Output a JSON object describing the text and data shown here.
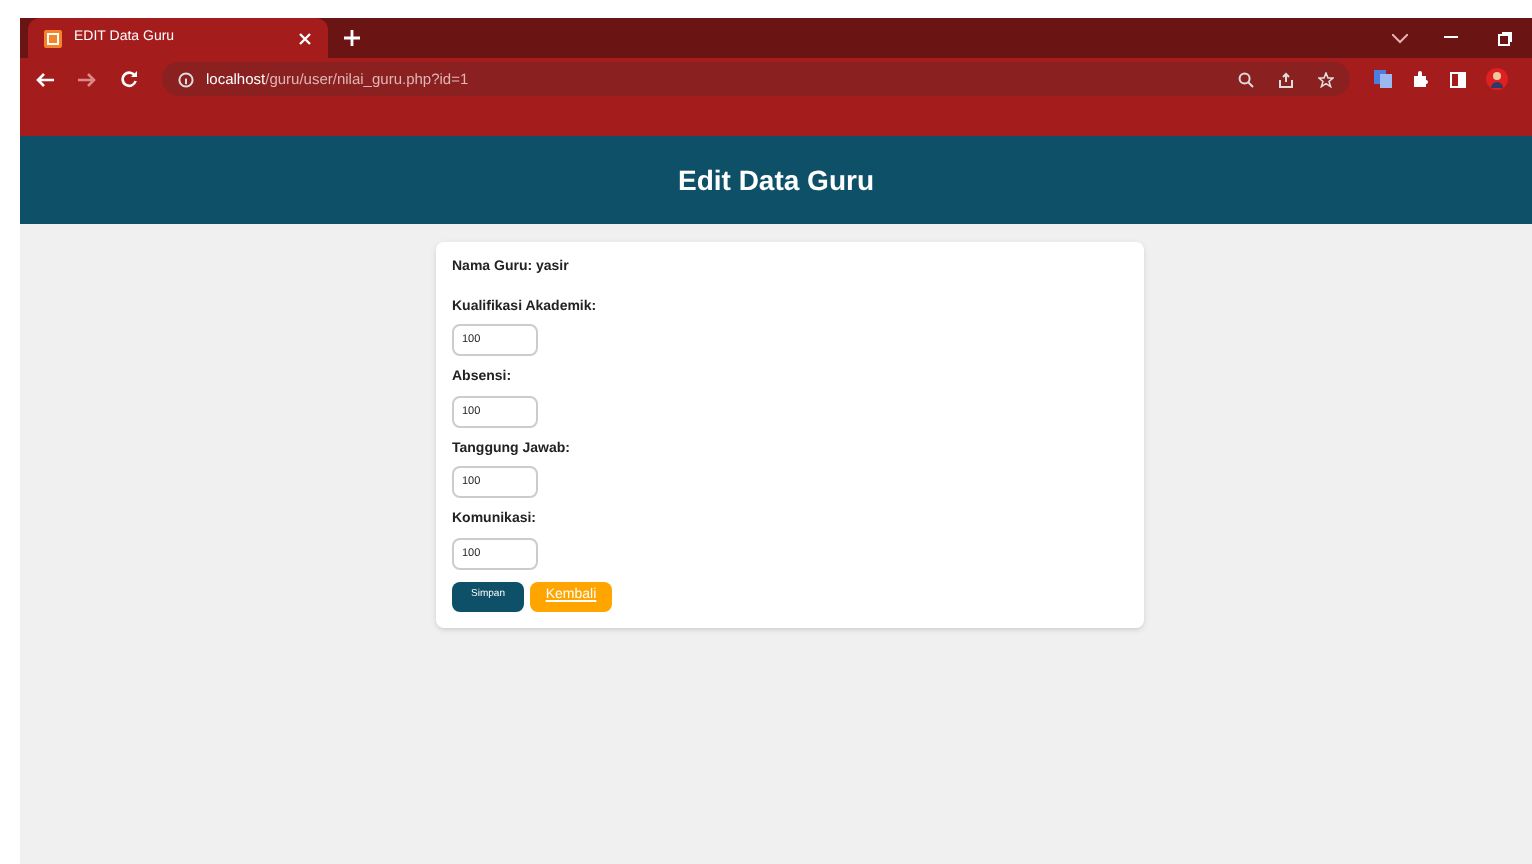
{
  "browser": {
    "tab_title": "EDIT Data Guru",
    "url_host": "localhost",
    "url_path": "/guru/user/nilai_guru.php?id=1"
  },
  "header": {
    "title": "Edit Data Guru"
  },
  "form": {
    "teacher_label": "Nama Guru: yasir",
    "fields": [
      {
        "label": "Kualifikasi Akademik:",
        "value": "100"
      },
      {
        "label": "Absensi:",
        "value": "100"
      },
      {
        "label": "Tanggung Jawab:",
        "value": "100"
      },
      {
        "label": "Komunikasi:",
        "value": "100"
      }
    ],
    "buttons": [
      {
        "kind": "submit",
        "label": "Simpan"
      },
      {
        "kind": "link",
        "label": "Kembali"
      }
    ]
  }
}
